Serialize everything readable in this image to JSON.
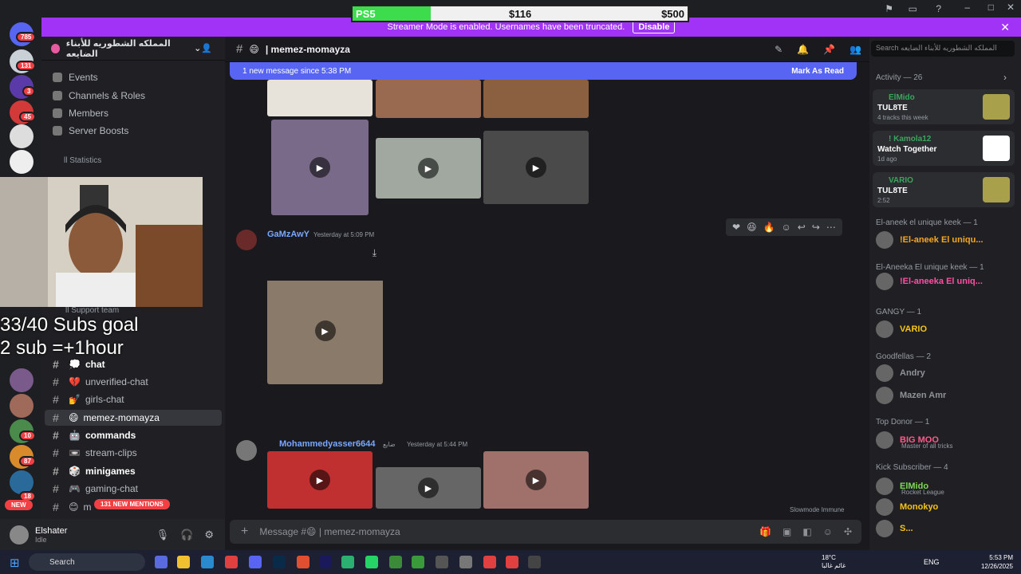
{
  "goal_bar": {
    "label": "PS5",
    "current": "$116",
    "target": "$500",
    "progress": 0.232
  },
  "streamer_mode": {
    "text": "Streamer Mode is enabled. Usernames have been truncated.",
    "button": "Disable"
  },
  "servers": {
    "badges": [
      "785",
      "131",
      "3",
      "45",
      "10",
      "87",
      "18"
    ],
    "new_label": "NEW"
  },
  "guild": {
    "name": "المملكه الشطوريه للأبناء الضايعه"
  },
  "menu": [
    "Events",
    "Channels & Roles",
    "Members",
    "Server Boosts"
  ],
  "categories": {
    "statistics": "ll Statistics",
    "support": "ll Support team"
  },
  "overlay": {
    "line1": "33/40 Subs goal",
    "line2": "2 sub =+1hour"
  },
  "channels": [
    {
      "name": "chat",
      "emoji": "💭",
      "bold": true
    },
    {
      "name": "unverified-chat",
      "emoji": "💔"
    },
    {
      "name": "girls-chat",
      "emoji": "💅"
    },
    {
      "name": "memez-momayza",
      "emoji": "😄",
      "selected": true
    },
    {
      "name": "commands",
      "emoji": "🤖",
      "bold": true
    },
    {
      "name": "stream-clips",
      "emoji": "📼"
    },
    {
      "name": "minigames",
      "emoji": "🎲",
      "bold": true
    },
    {
      "name": "gaming-chat",
      "emoji": "🎮"
    },
    {
      "name": "m",
      "emoji": "😊"
    }
  ],
  "mentions": "131 NEW MENTIONS",
  "user": {
    "name": "Elshater",
    "status": "Idle"
  },
  "header": {
    "channel": "| memez-momayza",
    "emoji": "😄"
  },
  "new_messages": {
    "text": "1 new message since 5:38 PM",
    "action": "Mark As Read"
  },
  "messages": [
    {
      "author": "GaMzAwY",
      "time": "Yesterday at 5:09 PM"
    },
    {
      "author": "Mohammedyasser6644",
      "time": "Yesterday at 5:44 PM",
      "tag": "ضايع"
    }
  ],
  "composer": {
    "placeholder": "Message #😄 | memez-momayza"
  },
  "slowmode": "Slowmode Immune",
  "search": {
    "placeholder": "Search المملكه الشطوريه للأبناء الضايعه"
  },
  "activity": {
    "title": "Activity — 26",
    "cards": [
      {
        "user": "ElMido",
        "title": "TUL8TE",
        "sub": "4 tracks this week"
      },
      {
        "user": "! Kamola12",
        "title": "Watch Together",
        "sub": "1d ago"
      },
      {
        "user": "VARIO",
        "title": "TUL8TE",
        "sub": "2:52"
      }
    ]
  },
  "member_groups": [
    {
      "header": "El-aneek el unique keek — 1",
      "members": [
        {
          "name": "!El-aneek El uniqu...",
          "color": "#f5a623"
        }
      ]
    },
    {
      "header": "El-Aneeka El unique keek — 1",
      "members": [
        {
          "name": "!El-aneeka El uniq...",
          "color": "#ff4fa3"
        }
      ]
    },
    {
      "header": "GANGY — 1",
      "members": [
        {
          "name": "VARIO",
          "color": "#f5c518"
        }
      ]
    },
    {
      "header": "Goodfellas — 2",
      "members": [
        {
          "name": "Andry",
          "color": "#8e9297"
        },
        {
          "name": "Mazen Amr",
          "color": "#8e9297"
        }
      ]
    },
    {
      "header": "Top Donor — 1",
      "members": [
        {
          "name": "BIG MOO",
          "color": "#ff5b8a",
          "sub": "Master of all tricks"
        }
      ]
    },
    {
      "header": "Kick Subscriber — 4",
      "members": [
        {
          "name": "ElMido",
          "color": "#7ed957",
          "sub": "Rocket League"
        },
        {
          "name": "Monokyo",
          "color": "#f5c518"
        },
        {
          "name": "S...",
          "color": "#f5c518"
        }
      ]
    }
  ],
  "taskbar": {
    "search": "Search",
    "weather_temp": "18°C",
    "weather_text": "غائم غالبا",
    "lang": "ENG",
    "time": "5:53 PM",
    "date": "12/26/2025"
  }
}
